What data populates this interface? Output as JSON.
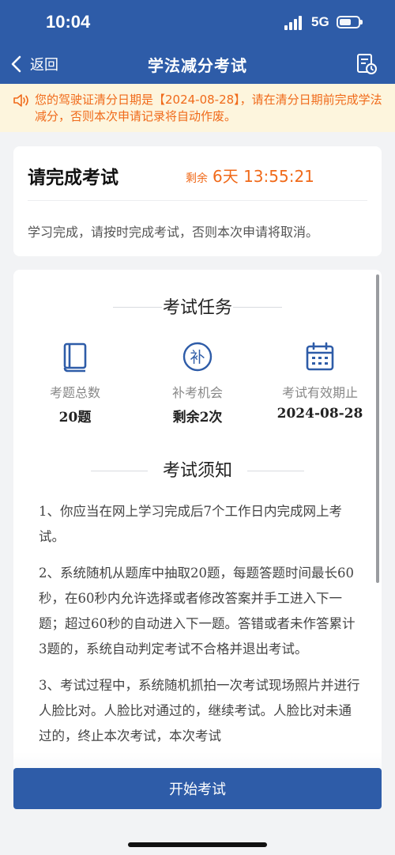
{
  "status_bar": {
    "time": "10:04",
    "network": "5G"
  },
  "nav": {
    "back_label": "返回",
    "title": "学法减分考试",
    "record_icon": "record-list-icon"
  },
  "notice": {
    "text": "您的驾驶证清分日期是【2024-08-28】，请在清分日期前完成学法减分，否则本次申请记录将自动作废。",
    "color": "#f06a1a"
  },
  "exam_card": {
    "heading": "请完成考试",
    "remaining_label": "剩余",
    "remaining_value": "6天 13:55:21",
    "description": "学习完成，请按时完成考试，否则本次申请将取消。"
  },
  "task": {
    "title": "考试任务",
    "stats": [
      {
        "icon": "book-icon",
        "label": "考题总数",
        "value": "20题"
      },
      {
        "icon": "makeup-icon",
        "glyph": "补",
        "label": "补考机会",
        "value": "剩余2次"
      },
      {
        "icon": "calendar-icon",
        "label": "考试有效期止",
        "value": "2024-08-28"
      }
    ]
  },
  "rules": {
    "title": "考试须知",
    "items": [
      "1、你应当在网上学习完成后7个工作日内完成网上考试。",
      "2、系统随机从题库中抽取20题，每题答题时间最长60秒，在60秒内允许选择或者修改答案并手工进入下一题；超过60秒的自动进入下一题。答错或者未作答累计3题的，系统自动判定考试不合格并退出考试。",
      "3、考试过程中，系统随机抓拍一次考试现场照片并进行人脸比对。人脸比对通过的，继续考试。人脸比对未通过的，终止本次考试，本次考试"
    ]
  },
  "start_button": {
    "label": "开始考试"
  },
  "colors": {
    "primary": "#2e5ca8",
    "accent": "#f06a1a",
    "notice_bg": "#fdf5dd",
    "page_bg": "#f2f3f5"
  }
}
